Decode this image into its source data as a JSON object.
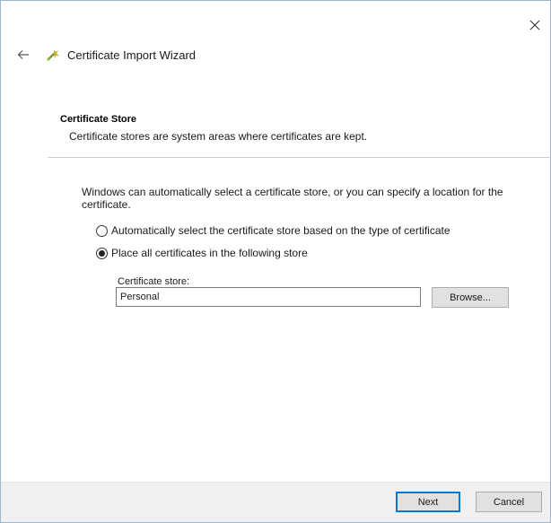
{
  "window": {
    "title": "Certificate Import Wizard"
  },
  "header": {
    "section_title": "Certificate Store",
    "section_description": "Certificate stores are system areas where certificates are kept."
  },
  "body": {
    "intro": "Windows can automatically select a certificate store, or you can specify a location for the certificate.",
    "options": [
      {
        "label": "Automatically select the certificate store based on the type of certificate",
        "selected": false
      },
      {
        "label": "Place all certificates in the following store",
        "selected": true
      }
    ],
    "store_label": "Certificate store:",
    "store_value": "Personal",
    "browse_label": "Browse..."
  },
  "footer": {
    "next_label": "Next",
    "cancel_label": "Cancel"
  },
  "colors": {
    "accent": "#0078d7",
    "footer_bg": "#f0f0f0",
    "button_bg": "#e1e1e1"
  },
  "icons": {
    "close": "close-icon",
    "back": "back-arrow-icon",
    "wizard": "certificate-wizard-icon"
  }
}
